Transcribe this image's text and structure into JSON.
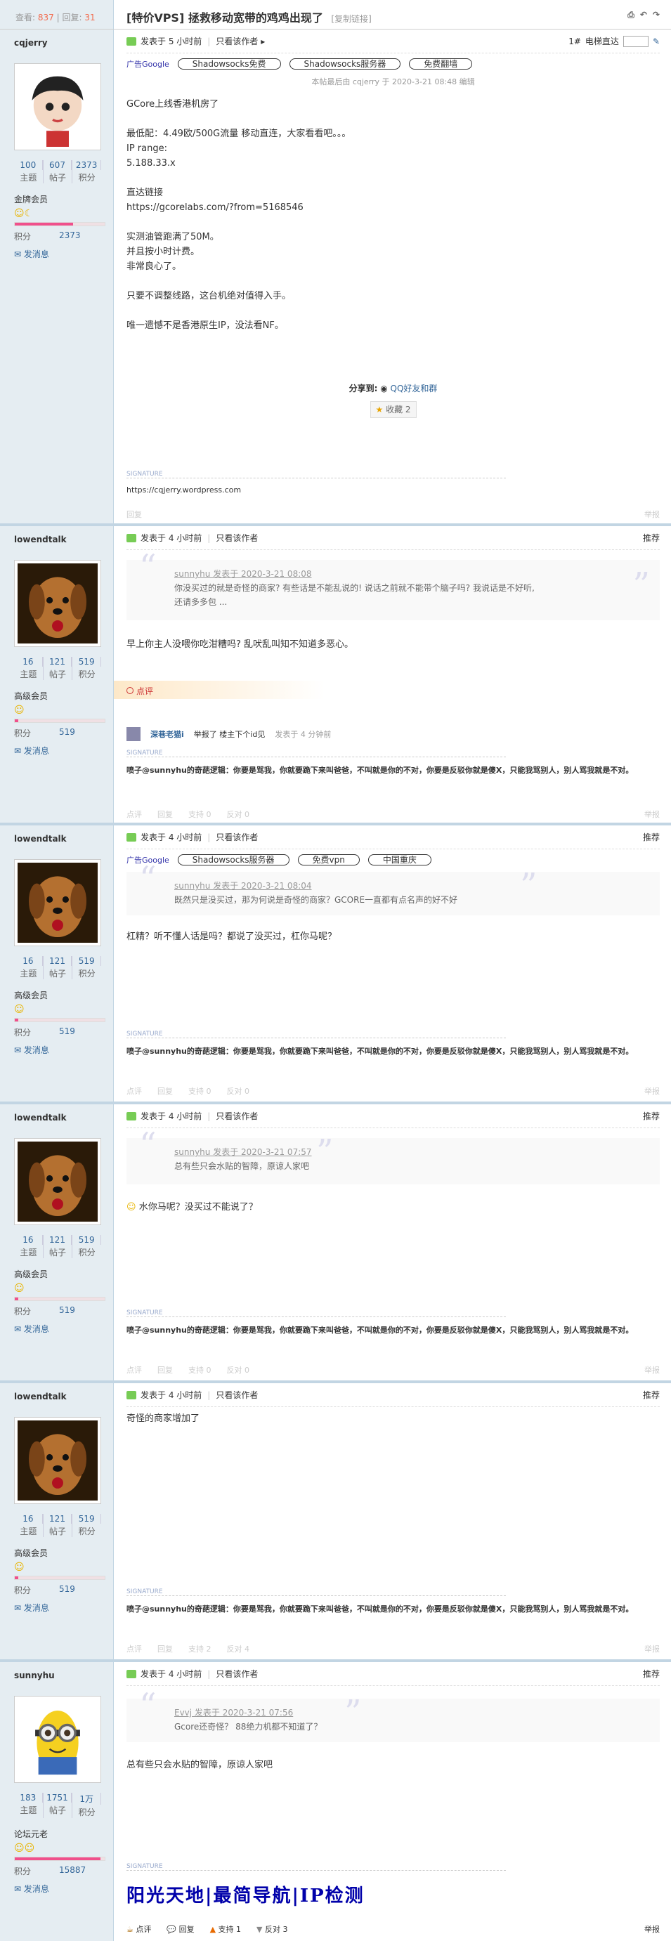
{
  "header": {
    "views_label": "查看:",
    "views": "837",
    "replies_label": "回复:",
    "replies": "31",
    "title": "[特价VPS] 拯救移动宽带的鸡鸡出现了",
    "copy_link": "[复制链接]"
  },
  "common": {
    "posted_prefix": "发表于",
    "only_author": "只看该作者",
    "recommend": "推荐",
    "send_msg": "发消息",
    "topic_l": "主题",
    "posts_l": "帖子",
    "credit_l": "积分",
    "top": "举报",
    "signature": "SIGNATURE"
  },
  "posts": [
    {
      "user": "cqjerry",
      "time": "5 小时前",
      "topics": "100",
      "posts": "607",
      "credits": "2373",
      "group": "金牌会员",
      "credit_val": "2373",
      "floor": "1#",
      "jump_label": "电梯直达",
      "ads": [
        "广告Google",
        "Shadowsocks免费",
        "Shadowsocks服务器",
        "免费翻墙"
      ],
      "edited": "本帖最后由 cqjerry 于 2020-3-21 08:48 编辑",
      "lines": [
        "GCore上线香港机房了",
        "",
        "最低配：4.49欧/500G流量 移动直连，大家看看吧。。。",
        "IP range:",
        "5.188.33.x",
        "",
        "直达链接",
        "https://gcorelabs.com/?from=5168546",
        "",
        "实测油管跑满了50M。",
        "并且按小时计费。",
        "非常良心了。",
        "",
        "只要不调整线路，这台机绝对值得入手。",
        "",
        "唯一遗憾不是香港原生IP，没法看NF。"
      ],
      "share_label": "分享到:",
      "share_target": "QQ好友和群",
      "fav": "收藏 2",
      "sig": "https://cqjerry.wordpress.com",
      "reply": "回复"
    },
    {
      "user": "lowendtalk",
      "time": "4 小时前",
      "topics": "16",
      "posts": "121",
      "credits": "519",
      "group": "高级会员",
      "credit_val": "519",
      "quote_head": "sunnyhu 发表于 2020-3-21 08:08",
      "quote_lines": [
        "你没买过的就是奇怪的商家? 有些话是不能乱说的! 说话之前就不能带个脑子吗? 我说话是不好听,",
        "还请多多包 ..."
      ],
      "text": "早上你主人没喂你吃泔糟吗? 乱吠乱叫知不知道多恶心。",
      "rate": "点评",
      "rater": "深巷老猫i",
      "rate_text": "举报了 楼主下个id见",
      "rate_time": "发表于 4 分钟前",
      "sig": "喷子@sunnyhu的奇葩逻辑：你要是骂我，你就要跪下来叫爸爸，不叫就是你的不对，你要是反驳你就是傻X，只能我骂别人，别人骂我就是不对。",
      "acts": [
        "点评",
        "回复",
        "支持 0",
        "反对 0"
      ]
    },
    {
      "user": "lowendtalk",
      "time": "4 小时前",
      "topics": "16",
      "posts": "121",
      "credits": "519",
      "group": "高级会员",
      "credit_val": "519",
      "ads": [
        "广告Google",
        "Shadowsocks服务器",
        "免费vpn",
        "中国重庆"
      ],
      "quote_head": "sunnyhu 发表于 2020-3-21 08:04",
      "quote_lines": [
        "既然只是没买过，那为何说是奇怪的商家？GCORE一直都有点名声的好不好"
      ],
      "text": "杠精？听不懂人话是吗？都说了没买过，杠你马呢？",
      "acts": [
        "点评",
        "回复",
        "支持 0",
        "反对 0"
      ]
    },
    {
      "user": "lowendtalk",
      "time": "4 小时前",
      "topics": "16",
      "posts": "121",
      "credits": "519",
      "group": "高级会员",
      "credit_val": "519",
      "quote_head": "sunnyhu 发表于 2020-3-21 07:57",
      "quote_lines": [
        "总有些只会水贴的智障，原谅人家吧"
      ],
      "text": "水你马呢？没买过不能说了？",
      "acts": [
        "点评",
        "回复",
        "支持 0",
        "反对 0"
      ]
    },
    {
      "user": "lowendtalk",
      "time": "4 小时前",
      "topics": "16",
      "posts": "121",
      "credits": "519",
      "group": "高级会员",
      "credit_val": "519",
      "text": "奇怪的商家增加了",
      "acts": [
        "点评",
        "回复",
        "支持 2",
        "反对 4"
      ]
    },
    {
      "user": "sunnyhu",
      "time": "4 小时前",
      "topics": "183",
      "posts": "1751",
      "credits": "1万",
      "group": "论坛元老",
      "credit_val": "15887",
      "quote_head": "Evvj 发表于 2020-3-21 07:56",
      "quote_lines": [
        "Gcore还奇怪？ 88绝力机都不知道了？"
      ],
      "text": "总有些只会水贴的智障，原谅人家吧",
      "big": "阳光天地|最简导航|IP检测",
      "acts": [
        "点评",
        "回复",
        "支持 1",
        "反对 3"
      ]
    }
  ]
}
